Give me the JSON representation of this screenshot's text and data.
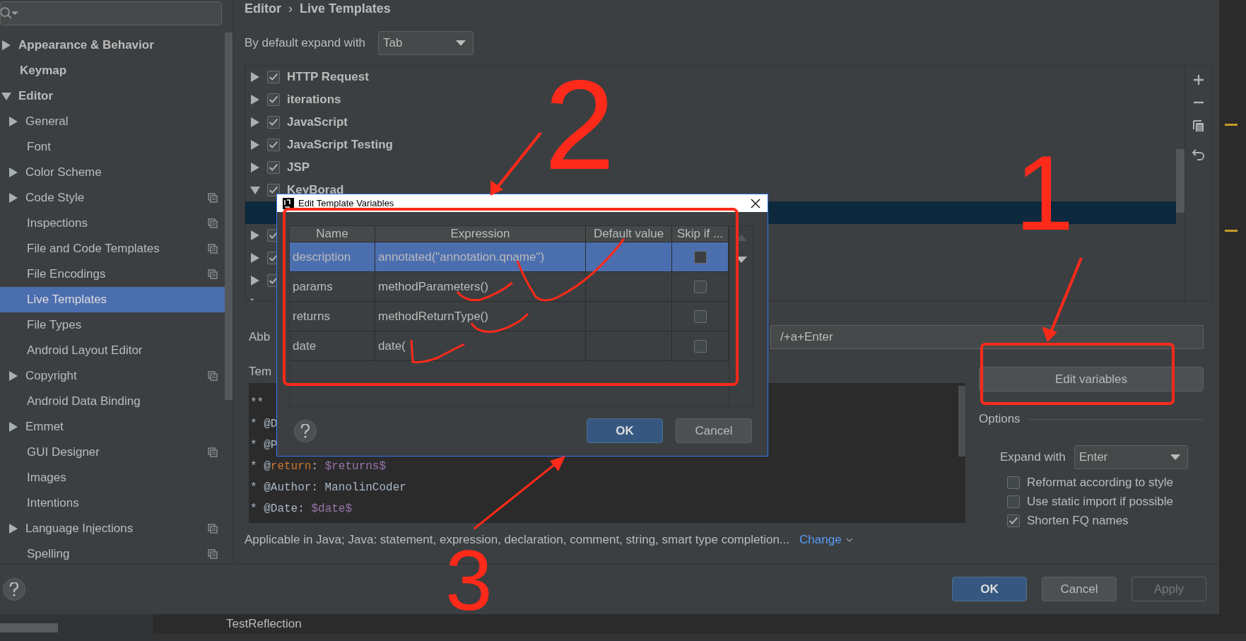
{
  "sidebar": {
    "items": [
      {
        "label": "Appearance & Behavior",
        "expanded": false,
        "selected": false
      },
      {
        "label": "Keymap",
        "selected": false
      },
      {
        "label": "Editor",
        "expanded": true,
        "selected": false,
        "children": [
          {
            "label": "General",
            "expanded": false,
            "project_icon": false,
            "selected": false
          },
          {
            "label": "Font",
            "project_icon": false,
            "selected": false
          },
          {
            "label": "Color Scheme",
            "expanded": false,
            "project_icon": false,
            "selected": false
          },
          {
            "label": "Code Style",
            "expanded": false,
            "project_icon": true,
            "selected": false
          },
          {
            "label": "Inspections",
            "project_icon": true,
            "selected": false
          },
          {
            "label": "File and Code Templates",
            "project_icon": true,
            "selected": false
          },
          {
            "label": "File Encodings",
            "project_icon": true,
            "selected": false
          },
          {
            "label": "Live Templates",
            "project_icon": false,
            "selected": true
          },
          {
            "label": "File Types",
            "project_icon": false,
            "selected": false
          },
          {
            "label": "Android Layout Editor",
            "project_icon": false,
            "selected": false
          },
          {
            "label": "Copyright",
            "expanded": false,
            "project_icon": true,
            "selected": false
          },
          {
            "label": "Android Data Binding",
            "project_icon": false,
            "selected": false
          },
          {
            "label": "Emmet",
            "expanded": false,
            "project_icon": false,
            "selected": false
          },
          {
            "label": "GUI Designer",
            "project_icon": true,
            "selected": false
          },
          {
            "label": "Images",
            "project_icon": false,
            "selected": false
          },
          {
            "label": "Intentions",
            "project_icon": false,
            "selected": false
          },
          {
            "label": "Language Injections",
            "expanded": false,
            "project_icon": true,
            "selected": false
          },
          {
            "label": "Spelling",
            "project_icon": true,
            "selected": false
          }
        ]
      }
    ]
  },
  "breadcrumb": {
    "items": [
      "Editor",
      "Live Templates"
    ],
    "separator": "›"
  },
  "expand_default": {
    "label": "By default expand with",
    "value": "Tab"
  },
  "template_groups": [
    {
      "label": "HTTP Request",
      "expanded": false,
      "checked": true
    },
    {
      "label": "iterations",
      "expanded": false,
      "checked": true
    },
    {
      "label": "JavaScript",
      "expanded": false,
      "checked": true
    },
    {
      "label": "JavaScript Testing",
      "expanded": false,
      "checked": true
    },
    {
      "label": "JSP",
      "expanded": false,
      "checked": true
    },
    {
      "label": "KeyBorad",
      "expanded": true,
      "checked": true,
      "children": [
        {
          "selected": true
        }
      ]
    },
    {
      "expanded": false,
      "checked": true
    },
    {
      "expanded": false,
      "checked": true
    },
    {
      "expanded": false,
      "checked": true
    },
    {
      "expanded": false
    }
  ],
  "abbreviation": {
    "label": "Abb",
    "value": "/+a+Enter"
  },
  "template_text": {
    "label": "Tem",
    "lines": [
      [
        {
          "text": "**",
          "kind": "plain"
        }
      ],
      [
        {
          "text": "* @D",
          "kind": "plain"
        }
      ],
      [
        {
          "text": "* @P",
          "kind": "plain"
        }
      ],
      [
        {
          "text": "* @",
          "kind": "plain"
        },
        {
          "text": "return",
          "kind": "keyword"
        },
        {
          "text": ": ",
          "kind": "plain"
        },
        {
          "text": "$returns$",
          "kind": "variable"
        }
      ],
      [
        {
          "text": "* @Author: ManolinCoder",
          "kind": "plain"
        }
      ],
      [
        {
          "text": "* @Date: ",
          "kind": "plain"
        },
        {
          "text": "$date$",
          "kind": "variable"
        }
      ]
    ]
  },
  "applicable": {
    "text": "Applicable in Java; Java: statement, expression, declaration, comment, string, smart type completion...",
    "link": "Change"
  },
  "edit_variables_button": "Edit variables",
  "options": {
    "title": "Options",
    "expand_with": {
      "label": "Expand with",
      "value": "Enter"
    },
    "checkboxes": [
      {
        "label": "Reformat according to style",
        "checked": false
      },
      {
        "label": "Use static import if possible",
        "checked": false
      },
      {
        "label": "Shorten FQ names",
        "checked": true
      }
    ]
  },
  "buttons": [
    {
      "label": "OK",
      "kind": "primary"
    },
    {
      "label": "Cancel",
      "kind": "normal"
    },
    {
      "label": "Apply",
      "kind": "disabled"
    }
  ],
  "dialog": {
    "title": "Edit Template Variables",
    "columns": [
      "Name",
      "Expression",
      "Default value",
      "Skip if ..."
    ],
    "rows": [
      {
        "name": "description",
        "expression": "annotated(\"annotation.qname\")",
        "skip": false,
        "selected": true
      },
      {
        "name": "params",
        "expression": "methodParameters()",
        "skip": false,
        "selected": false
      },
      {
        "name": "returns",
        "expression": "methodReturnType()",
        "skip": false,
        "selected": false
      },
      {
        "name": "date",
        "expression": "date(",
        "skip": false,
        "selected": false
      }
    ],
    "buttons": [
      {
        "label": "OK",
        "kind": "primary"
      },
      {
        "label": "Cancel",
        "kind": "normal"
      }
    ]
  },
  "bottom_tab": "TestReflection",
  "annotations": {
    "numbers": [
      "1",
      "2",
      "3"
    ]
  }
}
